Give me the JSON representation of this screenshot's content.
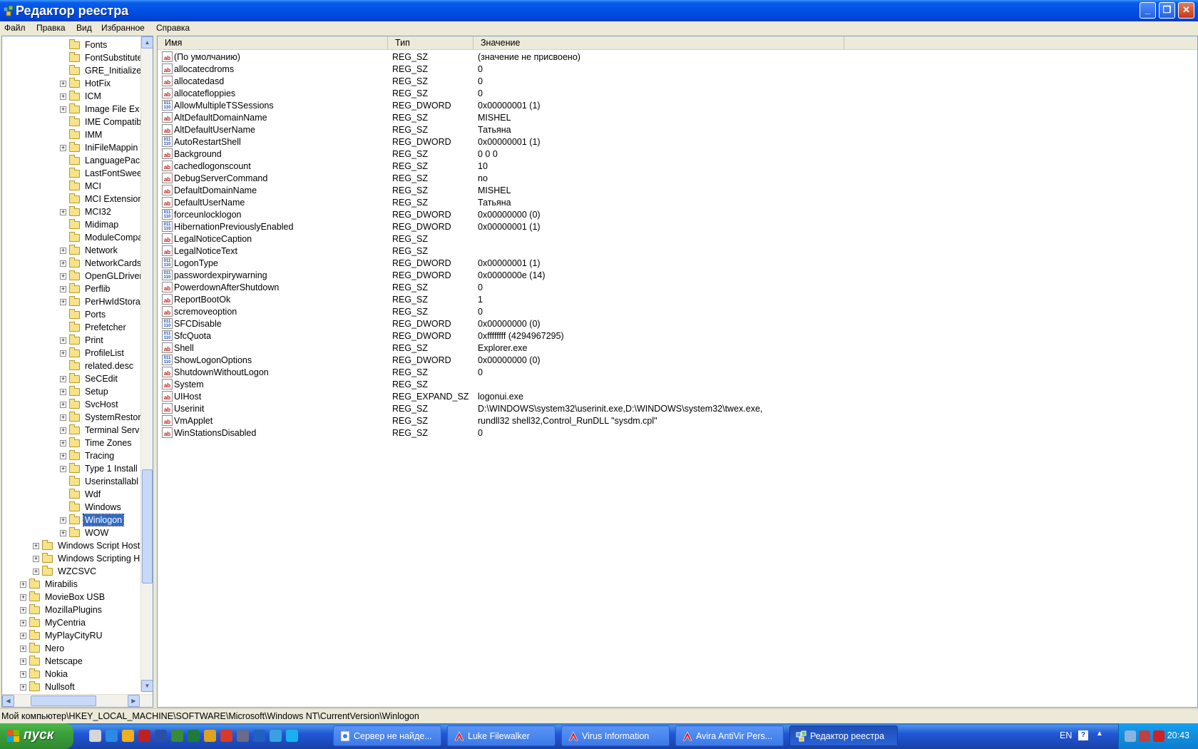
{
  "window": {
    "title": "Редактор реестра",
    "buttons": {
      "minimize": "_",
      "maximize": "❐",
      "close": "✕"
    }
  },
  "menu": [
    "Файл",
    "Правка",
    "Вид",
    "Избранное",
    "Справка"
  ],
  "tree": {
    "selected": "Winlogon",
    "items": [
      {
        "label": "Fonts",
        "expand": false,
        "level": 2
      },
      {
        "label": "FontSubstitute",
        "expand": false,
        "level": 2
      },
      {
        "label": "GRE_Initialize",
        "expand": false,
        "level": 2
      },
      {
        "label": "HotFix",
        "expand": true,
        "level": 2
      },
      {
        "label": "ICM",
        "expand": true,
        "level": 2
      },
      {
        "label": "Image File Ex",
        "expand": true,
        "level": 2
      },
      {
        "label": "IME Compatib",
        "expand": false,
        "level": 2
      },
      {
        "label": "IMM",
        "expand": false,
        "level": 2
      },
      {
        "label": "IniFileMappin",
        "expand": true,
        "level": 2
      },
      {
        "label": "LanguagePack",
        "expand": false,
        "level": 2
      },
      {
        "label": "LastFontSwee",
        "expand": false,
        "level": 2
      },
      {
        "label": "MCI",
        "expand": false,
        "level": 2
      },
      {
        "label": "MCI Extension",
        "expand": false,
        "level": 2
      },
      {
        "label": "MCI32",
        "expand": true,
        "level": 2
      },
      {
        "label": "Midimap",
        "expand": false,
        "level": 2
      },
      {
        "label": "ModuleCompa",
        "expand": false,
        "level": 2
      },
      {
        "label": "Network",
        "expand": true,
        "level": 2
      },
      {
        "label": "NetworkCards",
        "expand": true,
        "level": 2
      },
      {
        "label": "OpenGLDriver",
        "expand": true,
        "level": 2
      },
      {
        "label": "Perflib",
        "expand": true,
        "level": 2
      },
      {
        "label": "PerHwIdStora",
        "expand": true,
        "level": 2
      },
      {
        "label": "Ports",
        "expand": false,
        "level": 2
      },
      {
        "label": "Prefetcher",
        "expand": false,
        "level": 2
      },
      {
        "label": "Print",
        "expand": true,
        "level": 2
      },
      {
        "label": "ProfileList",
        "expand": true,
        "level": 2
      },
      {
        "label": "related.desc",
        "expand": false,
        "level": 2
      },
      {
        "label": "SeCEdit",
        "expand": true,
        "level": 2
      },
      {
        "label": "Setup",
        "expand": true,
        "level": 2
      },
      {
        "label": "SvcHost",
        "expand": true,
        "level": 2
      },
      {
        "label": "SystemRestor",
        "expand": true,
        "level": 2
      },
      {
        "label": "Terminal Serv",
        "expand": true,
        "level": 2
      },
      {
        "label": "Time Zones",
        "expand": true,
        "level": 2
      },
      {
        "label": "Tracing",
        "expand": true,
        "level": 2
      },
      {
        "label": "Type 1 Install",
        "expand": true,
        "level": 2
      },
      {
        "label": "Userinstallabl",
        "expand": false,
        "level": 2
      },
      {
        "label": "Wdf",
        "expand": false,
        "level": 2
      },
      {
        "label": "Windows",
        "expand": false,
        "level": 2
      },
      {
        "label": "Winlogon",
        "expand": true,
        "level": 2
      },
      {
        "label": "WOW",
        "expand": true,
        "level": 2
      },
      {
        "label": "Windows Script Host",
        "expand": true,
        "level": 1
      },
      {
        "label": "Windows Scripting H",
        "expand": true,
        "level": 1
      },
      {
        "label": "WZCSVC",
        "expand": true,
        "level": 1
      },
      {
        "label": "Mirabilis",
        "expand": true,
        "level": 0
      },
      {
        "label": "MovieBox USB",
        "expand": true,
        "level": 0
      },
      {
        "label": "MozillaPlugins",
        "expand": true,
        "level": 0
      },
      {
        "label": "MyCentria",
        "expand": true,
        "level": 0
      },
      {
        "label": "MyPlayCityRU",
        "expand": true,
        "level": 0
      },
      {
        "label": "Nero",
        "expand": true,
        "level": 0
      },
      {
        "label": "Netscape",
        "expand": true,
        "level": 0
      },
      {
        "label": "Nokia",
        "expand": true,
        "level": 0
      },
      {
        "label": "Nullsoft",
        "expand": true,
        "level": 0
      }
    ]
  },
  "list": {
    "columns": [
      "Имя",
      "Тип",
      "Значение"
    ],
    "rows": [
      {
        "icon": "ab",
        "name": "(По умолчанию)",
        "type": "REG_SZ",
        "value": "(значение не присвоено)"
      },
      {
        "icon": "ab",
        "name": "allocatecdroms",
        "type": "REG_SZ",
        "value": "0"
      },
      {
        "icon": "ab",
        "name": "allocatedasd",
        "type": "REG_SZ",
        "value": "0"
      },
      {
        "icon": "ab",
        "name": "allocatefloppies",
        "type": "REG_SZ",
        "value": "0"
      },
      {
        "icon": "bin",
        "name": "AllowMultipleTSSessions",
        "type": "REG_DWORD",
        "value": "0x00000001 (1)"
      },
      {
        "icon": "ab",
        "name": "AltDefaultDomainName",
        "type": "REG_SZ",
        "value": "MISHEL"
      },
      {
        "icon": "ab",
        "name": "AltDefaultUserName",
        "type": "REG_SZ",
        "value": "Татьяна"
      },
      {
        "icon": "bin",
        "name": "AutoRestartShell",
        "type": "REG_DWORD",
        "value": "0x00000001 (1)"
      },
      {
        "icon": "ab",
        "name": "Background",
        "type": "REG_SZ",
        "value": "0 0 0"
      },
      {
        "icon": "ab",
        "name": "cachedlogonscount",
        "type": "REG_SZ",
        "value": "10"
      },
      {
        "icon": "ab",
        "name": "DebugServerCommand",
        "type": "REG_SZ",
        "value": "no"
      },
      {
        "icon": "ab",
        "name": "DefaultDomainName",
        "type": "REG_SZ",
        "value": "MISHEL"
      },
      {
        "icon": "ab",
        "name": "DefaultUserName",
        "type": "REG_SZ",
        "value": "Татьяна"
      },
      {
        "icon": "bin",
        "name": "forceunlocklogon",
        "type": "REG_DWORD",
        "value": "0x00000000 (0)"
      },
      {
        "icon": "bin",
        "name": "HibernationPreviouslyEnabled",
        "type": "REG_DWORD",
        "value": "0x00000001 (1)"
      },
      {
        "icon": "ab",
        "name": "LegalNoticeCaption",
        "type": "REG_SZ",
        "value": ""
      },
      {
        "icon": "ab",
        "name": "LegalNoticeText",
        "type": "REG_SZ",
        "value": ""
      },
      {
        "icon": "bin",
        "name": "LogonType",
        "type": "REG_DWORD",
        "value": "0x00000001 (1)"
      },
      {
        "icon": "bin",
        "name": "passwordexpirywarning",
        "type": "REG_DWORD",
        "value": "0x0000000e (14)"
      },
      {
        "icon": "ab",
        "name": "PowerdownAfterShutdown",
        "type": "REG_SZ",
        "value": "0"
      },
      {
        "icon": "ab",
        "name": "ReportBootOk",
        "type": "REG_SZ",
        "value": "1"
      },
      {
        "icon": "ab",
        "name": "scremoveoption",
        "type": "REG_SZ",
        "value": "0"
      },
      {
        "icon": "bin",
        "name": "SFCDisable",
        "type": "REG_DWORD",
        "value": "0x00000000 (0)"
      },
      {
        "icon": "bin",
        "name": "SfcQuota",
        "type": "REG_DWORD",
        "value": "0xffffffff (4294967295)"
      },
      {
        "icon": "ab",
        "name": "Shell",
        "type": "REG_SZ",
        "value": "Explorer.exe"
      },
      {
        "icon": "bin",
        "name": "ShowLogonOptions",
        "type": "REG_DWORD",
        "value": "0x00000000 (0)"
      },
      {
        "icon": "ab",
        "name": "ShutdownWithoutLogon",
        "type": "REG_SZ",
        "value": "0"
      },
      {
        "icon": "ab",
        "name": "System",
        "type": "REG_SZ",
        "value": ""
      },
      {
        "icon": "ab",
        "name": "UIHost",
        "type": "REG_EXPAND_SZ",
        "value": "logonui.exe"
      },
      {
        "icon": "ab",
        "name": "Userinit",
        "type": "REG_SZ",
        "value": "D:\\WINDOWS\\system32\\userinit.exe,D:\\WINDOWS\\system32\\twex.exe,"
      },
      {
        "icon": "ab",
        "name": "VmApplet",
        "type": "REG_SZ",
        "value": "rundll32 shell32,Control_RunDLL \"sysdm.cpl\""
      },
      {
        "icon": "ab",
        "name": "WinStationsDisabled",
        "type": "REG_SZ",
        "value": "0"
      }
    ]
  },
  "status": "Мой компьютер\\HKEY_LOCAL_MACHINE\\SOFTWARE\\Microsoft\\Windows NT\\CurrentVersion\\Winlogon",
  "taskbar": {
    "start_label": "пуск",
    "tasks": [
      {
        "label": "Сервер не найде...",
        "icon": "ie-page-icon",
        "active": false
      },
      {
        "label": "Luke Filewalker",
        "icon": "avira-umbrella-icon",
        "active": false
      },
      {
        "label": "Virus Information",
        "icon": "avira-umbrella-icon",
        "active": false
      },
      {
        "label": "Avira AntiVir Pers...",
        "icon": "avira-umbrella-icon",
        "active": false
      },
      {
        "label": "Редактор реестра",
        "icon": "regedit-icon",
        "active": true
      }
    ],
    "lang": "EN",
    "clock": "20:43"
  },
  "colors": {
    "titlebar": "#0050e6",
    "selection": "#316ac5",
    "taskbar": "#2157d7",
    "start": "#3c9f3c"
  }
}
